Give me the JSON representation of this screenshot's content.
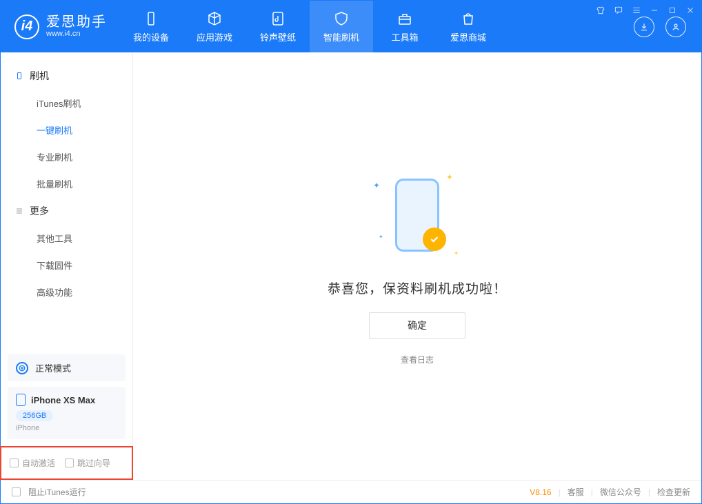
{
  "app": {
    "name_cn": "爱思助手",
    "name_en": "www.i4.cn"
  },
  "nav": {
    "my_device": "我的设备",
    "apps_games": "应用游戏",
    "ring_wall": "铃声壁纸",
    "smart_flash": "智能刷机",
    "toolbox": "工具箱",
    "store": "爱思商城"
  },
  "sidebar": {
    "section_flash": "刷机",
    "items_flash": {
      "itunes": "iTunes刷机",
      "onekey": "一键刷机",
      "pro": "专业刷机",
      "batch": "批量刷机"
    },
    "section_more": "更多",
    "items_more": {
      "other": "其他工具",
      "firmware": "下载固件",
      "advanced": "高级功能"
    }
  },
  "device": {
    "mode": "正常模式",
    "name": "iPhone XS Max",
    "capacity": "256GB",
    "type": "iPhone"
  },
  "options": {
    "auto_activate": "自动激活",
    "skip_guide": "跳过向导"
  },
  "main": {
    "success_msg": "恭喜您，保资料刷机成功啦！",
    "ok": "确定",
    "view_log": "查看日志"
  },
  "statusbar": {
    "block_itunes": "阻止iTunes运行",
    "version": "V8.16",
    "support": "客服",
    "wechat": "微信公众号",
    "update": "检查更新"
  }
}
